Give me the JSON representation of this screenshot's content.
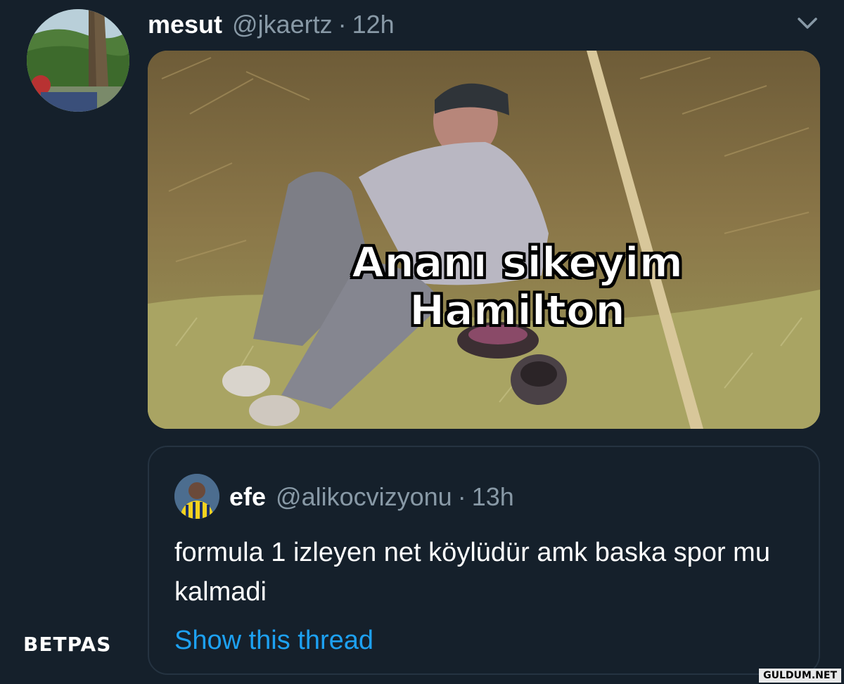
{
  "tweet": {
    "display_name": "mesut",
    "handle": "@jkaertz",
    "separator": "·",
    "time": "12h",
    "caret_icon": "chevron-down-icon"
  },
  "media": {
    "caption_line1": "Ananı sikeyim",
    "caption_line2": "Hamilton"
  },
  "quoted_tweet": {
    "display_name": "efe",
    "handle": "@alikocvizyonu",
    "separator": "·",
    "time": "13h",
    "text": "formula 1 izleyen net köylüdür amk baska spor mu kalmadi",
    "show_thread": "Show this thread"
  },
  "watermarks": {
    "brand": "BETPAS",
    "site": "GULDUM.NET"
  },
  "colors": {
    "background": "#15202b",
    "muted": "#8899a6",
    "link": "#1da1f2",
    "border": "#253341"
  }
}
